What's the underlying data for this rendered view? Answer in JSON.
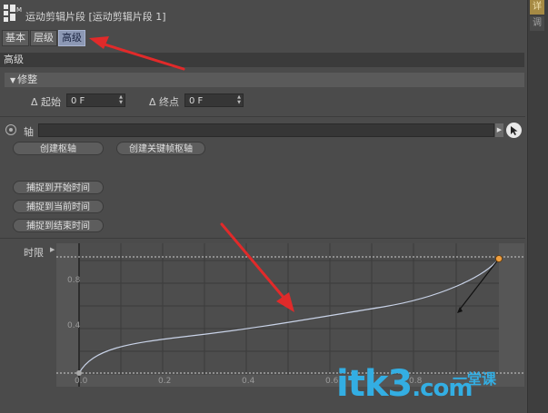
{
  "window": {
    "title": "运动剪辑片段 [运动剪辑片段 1]"
  },
  "tabs": [
    {
      "label": "基本",
      "active": false
    },
    {
      "label": "层级",
      "active": false
    },
    {
      "label": "高级",
      "active": true
    }
  ],
  "side_tabs": [
    "详",
    "调"
  ],
  "section": {
    "title": "高级"
  },
  "trim": {
    "title": "修整",
    "start_label": "Δ 起始",
    "start_value": "0 F",
    "end_label": "Δ 终点",
    "end_value": "0 F"
  },
  "axis": {
    "label": "轴",
    "value": ""
  },
  "buttons": {
    "create_pivot": "创建枢轴",
    "create_key_pivot": "创建关键帧枢轴",
    "snap_start": "捕捉到开始时间",
    "snap_current": "捕捉到当前时间",
    "snap_end": "捕捉到结束时间"
  },
  "graph": {
    "label": "时限",
    "x_ticks": [
      "0.0",
      "0.2",
      "0.4",
      "0.6",
      "0.8"
    ],
    "y_ticks": [
      "0.4",
      "0.8"
    ]
  },
  "watermark": {
    "main": "itk3",
    "suffix": ".com",
    "tagline": "一堂课"
  },
  "colors": {
    "accent": "#8c98b4",
    "arrow": "#e12a2a",
    "watermark": "#33aee3",
    "key_point": "#f0a040"
  }
}
